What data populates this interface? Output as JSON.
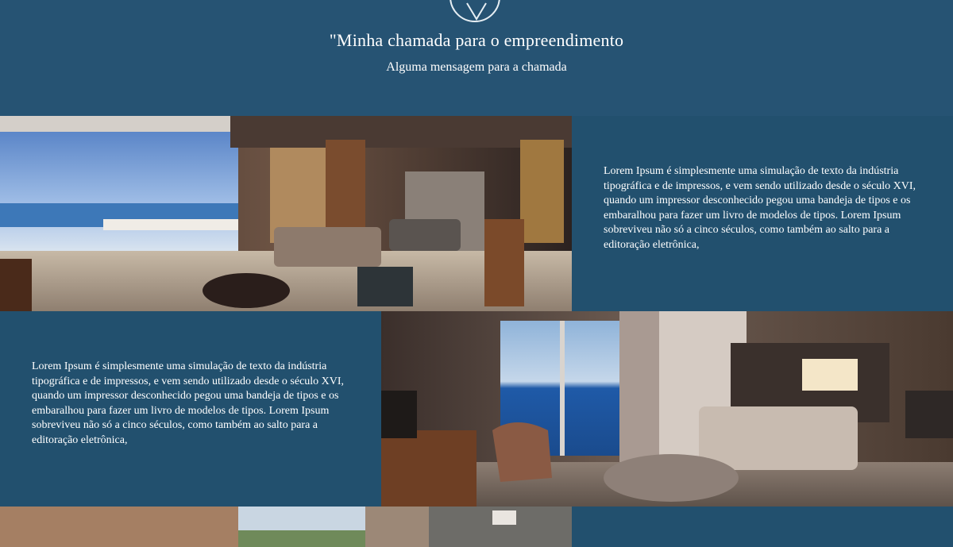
{
  "header": {
    "icon": "checkmark-chevron-icon",
    "title": "\"Minha chamada para o empreendimento",
    "subtitle": "Alguma mensagem para a chamada"
  },
  "features": [
    {
      "image_subject": "living-dining-room-render",
      "text": "Lorem Ipsum é simplesmente uma simulação de texto da indústria tipográfica e de impressos, e vem sendo utilizado desde o século XVI, quando um impressor desconhecido pegou uma bandeja de tipos e os embaralhou para fazer um livro de modelos de tipos. Lorem Ipsum sobreviveu não só a cinco séculos, como também ao salto para a editoração eletrônica,"
    },
    {
      "image_subject": "ocean-view-living-room-render",
      "text": "Lorem Ipsum é simplesmente uma simulação de texto da indústria tipográfica e de impressos, e vem sendo utilizado desde o século XVI, quando um impressor desconhecido pegou uma bandeja de tipos e os embaralhou para fazer um livro de modelos de tipos. Lorem Ipsum sobreviveu não só a cinco séculos, como também ao salto para a editoração eletrônica,"
    },
    {
      "image_subject": "balcony-room-render",
      "text": ""
    }
  ],
  "colors": {
    "background": "#22506e",
    "hero_background": "#265373"
  }
}
